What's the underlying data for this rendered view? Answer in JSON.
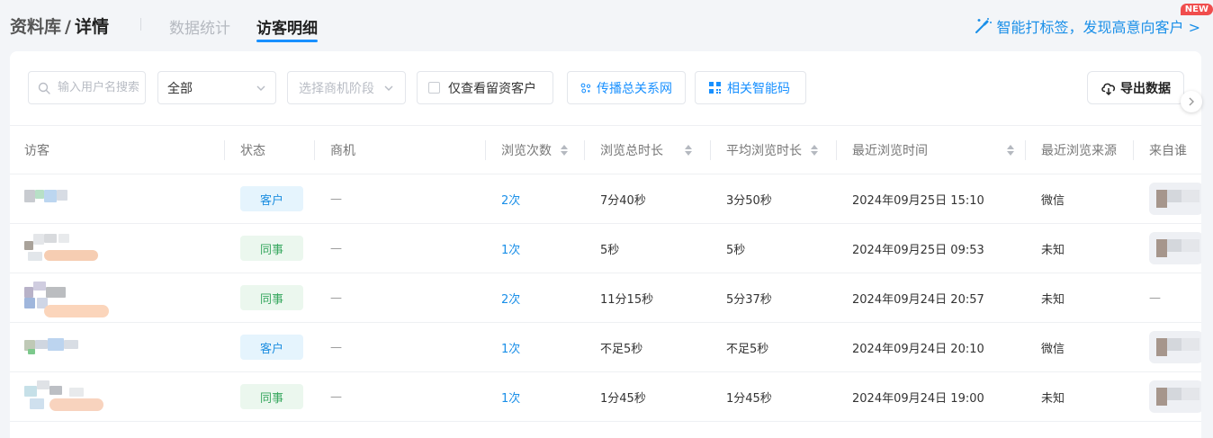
{
  "header": {
    "breadcrumb_root": "资料库",
    "breadcrumb_sep": "/",
    "breadcrumb_current": "详情",
    "tabs": [
      {
        "label": "数据统计",
        "active": false
      },
      {
        "label": "访客明细",
        "active": true
      }
    ],
    "promo_text": "智能打标签，发现高意向客户 >",
    "promo_badge": "NEW"
  },
  "toolbar": {
    "search_placeholder": "输入用户名搜索",
    "filter_all": "全部",
    "stage_placeholder": "选择商机阶段",
    "only_retained_label": "仅查看留资客户",
    "network_button": "传播总关系网",
    "smart_code_button": "相关智能码",
    "export_button": "导出数据"
  },
  "table": {
    "columns": [
      {
        "label": "访客",
        "sortable": false
      },
      {
        "label": "状态",
        "sortable": false
      },
      {
        "label": "商机",
        "sortable": false
      },
      {
        "label": "浏览次数",
        "sortable": true
      },
      {
        "label": "浏览总时长",
        "sortable": true
      },
      {
        "label": "平均浏览时长",
        "sortable": true
      },
      {
        "label": "最近浏览时间",
        "sortable": true
      },
      {
        "label": "最近浏览来源",
        "sortable": false
      },
      {
        "label": "来自谁",
        "sortable": false
      }
    ],
    "rows": [
      {
        "status": "客户",
        "status_type": "customer",
        "opportunity": "—",
        "views": "2次",
        "total_time": "7分40秒",
        "avg_time": "3分50秒",
        "last_view": "2024年09月25日 15:10",
        "source": "微信",
        "from": ""
      },
      {
        "status": "同事",
        "status_type": "colleague",
        "opportunity": "—",
        "views": "1次",
        "total_time": "5秒",
        "avg_time": "5秒",
        "last_view": "2024年09月25日 09:53",
        "source": "未知",
        "from": ""
      },
      {
        "status": "同事",
        "status_type": "colleague",
        "opportunity": "—",
        "views": "2次",
        "total_time": "11分15秒",
        "avg_time": "5分37秒",
        "last_view": "2024年09月24日 20:57",
        "source": "未知",
        "from": "—"
      },
      {
        "status": "客户",
        "status_type": "customer",
        "opportunity": "—",
        "views": "1次",
        "total_time": "不足5秒",
        "avg_time": "不足5秒",
        "last_view": "2024年09月24日 20:10",
        "source": "微信",
        "from": ""
      },
      {
        "status": "同事",
        "status_type": "colleague",
        "opportunity": "—",
        "views": "1次",
        "total_time": "1分45秒",
        "avg_time": "1分45秒",
        "last_view": "2024年09月24日 19:00",
        "source": "未知",
        "from": ""
      }
    ]
  },
  "colors": {
    "accent": "#1890ff",
    "customer_tag_bg": "#e5f4fd",
    "colleague_tag_bg": "#ebf7ee",
    "new_badge": "#f04d4d"
  },
  "icons": [
    "magic-wand-icon",
    "search-icon",
    "chevron-down-icon",
    "network-icon",
    "qrcode-icon",
    "cloud-download-icon",
    "chevron-right-icon"
  ]
}
